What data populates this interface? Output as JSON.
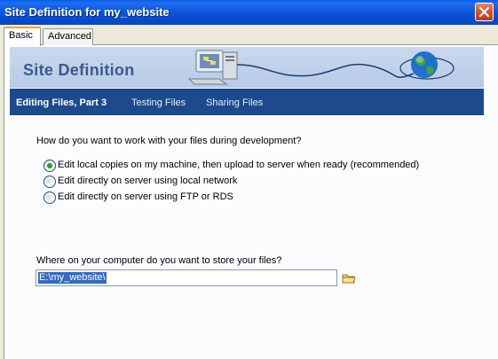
{
  "window": {
    "title": "Site Definition for my_website"
  },
  "tabs": [
    {
      "label": "Basic",
      "selected": true
    },
    {
      "label": "Advanced",
      "selected": false
    }
  ],
  "banner": {
    "title": "Site Definition"
  },
  "steps": [
    {
      "label": "Editing Files, Part 3",
      "active": true
    },
    {
      "label": "Testing Files",
      "active": false
    },
    {
      "label": "Sharing Files",
      "active": false
    }
  ],
  "form": {
    "question": "How do you want to work with your files during development?",
    "options": [
      {
        "label": "Edit local copies on my machine, then upload to server when ready (recommended)",
        "selected": true
      },
      {
        "label": "Edit directly on server using local network",
        "selected": false
      },
      {
        "label": "Edit directly on server using FTP or RDS",
        "selected": false
      }
    ],
    "location_question": "Where on your computer do you want to store your files?",
    "location_value": "E:\\my_website\\"
  },
  "icons": {
    "close": "close-icon",
    "folder": "folder-icon",
    "computer": "computer-icon",
    "globe": "globe-icon"
  },
  "colors": {
    "titlebar": "#0b55d8",
    "stepbar": "#1c4a8c",
    "banner": "#c9d8ec",
    "selection": "#316ac5"
  }
}
